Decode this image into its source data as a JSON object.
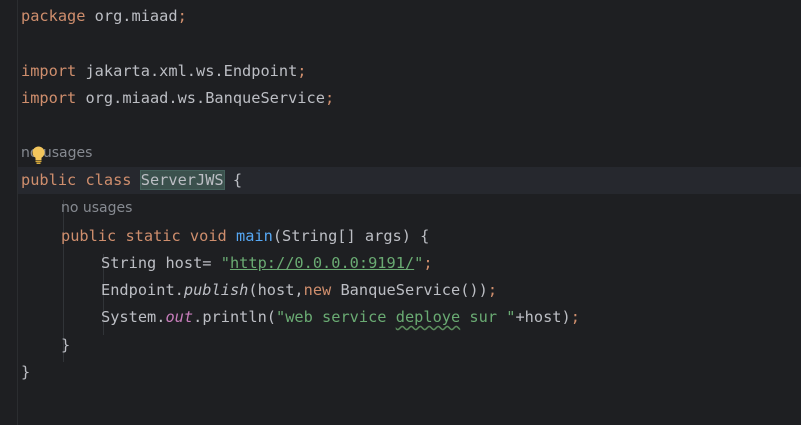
{
  "code": {
    "line1": {
      "kw": "package",
      "rest": " org.miaad",
      "semi": ";"
    },
    "line3": {
      "kw": "import",
      "rest": " jakarta.xml.ws.Endpoint",
      "semi": ";"
    },
    "line4": {
      "kw": "import",
      "rest": " org.miaad.ws.BanqueService",
      "semi": ";"
    },
    "hint_class_usages": "no usages",
    "class_decl": {
      "kw": "public class ",
      "name": "ServerJWS",
      "brace": " {"
    },
    "hint_method_usages": "no usages",
    "method_decl": {
      "kw": "public static void ",
      "name": "main",
      "params": "(String[] args) {"
    },
    "host_line": {
      "pre": "String host= ",
      "quote_open": "\"",
      "url": "http://0.0.0.0:9191/",
      "quote_close": "\"",
      "semi": ";"
    },
    "publish_line": {
      "pre": "Endpoint.",
      "method": "publish",
      "args_open": "(host,",
      "kw_new": "new",
      "args_rest": " BanqueService())",
      "semi": ";"
    },
    "println_line": {
      "pre": "System.",
      "field": "out",
      "call": ".println(",
      "str_a": "\"web service ",
      "str_typo": "deploye",
      "str_b": " sur \"",
      "rest": "+host)",
      "semi": ";"
    },
    "method_close": "}",
    "class_close": "}"
  },
  "icons": {
    "intention": "lightbulb-icon"
  },
  "colors": {
    "background": "#1e1f22",
    "keyword": "#cf8e6d",
    "string": "#6aab73",
    "method_name": "#56a8f5",
    "static_field": "#c77dbb",
    "default_text": "#bcbec4",
    "hint": "#868a91",
    "current_line": "#26282e"
  }
}
